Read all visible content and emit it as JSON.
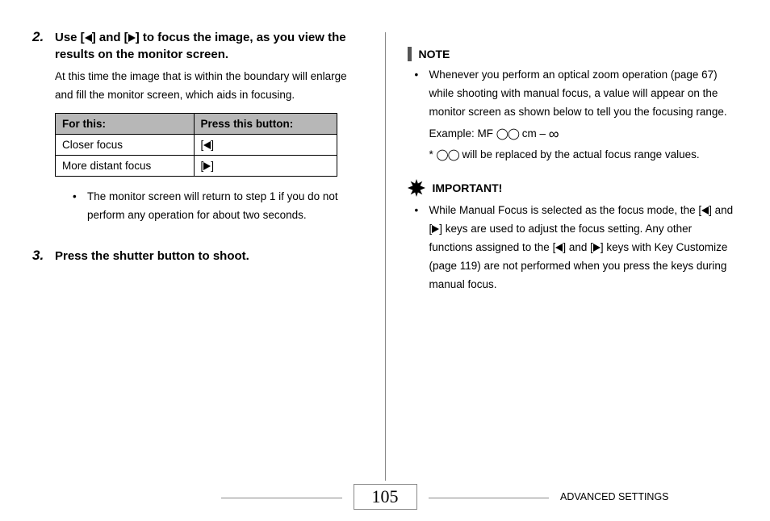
{
  "left": {
    "step2": {
      "num": "2.",
      "title_a": "Use [",
      "title_b": "] and [",
      "title_c": "] to focus the image, as you view the results on the monitor screen.",
      "body": "At this time the image that is within the boundary will enlarge and fill the monitor screen, which aids in focusing."
    },
    "table": {
      "h1": "For this:",
      "h2": "Press this button:",
      "r1c1": "Closer focus",
      "r2c1": "More distant focus"
    },
    "bullet1": "The monitor screen will return to step 1 if you do not perform any operation for about two seconds.",
    "step3": {
      "num": "3.",
      "title": "Press the shutter button to shoot."
    }
  },
  "right": {
    "note_label": "NOTE",
    "note_bullet_a": "Whenever you perform an optical zoom operation (page 67) while shooting with manual focus, a value will appear on the monitor screen as shown below to tell you the focusing range.",
    "note_example_prefix": "Example: MF ",
    "note_example_mid": " cm – ",
    "note_star_prefix": "*   ",
    "note_star_body": " will be replaced by the actual focus range values.",
    "important_label": "IMPORTANT!",
    "important_bullet_a": "While Manual Focus is selected as the focus mode, the [",
    "important_bullet_b": "] and [",
    "important_bullet_c": "] keys are used to adjust the focus setting. Any other functions assigned to the [",
    "important_bullet_d": "] and [",
    "important_bullet_e": "] keys with Key Customize (page 119) are not performed when you press the keys during manual focus."
  },
  "footer": {
    "page_num": "105",
    "section": "ADVANCED SETTINGS"
  }
}
